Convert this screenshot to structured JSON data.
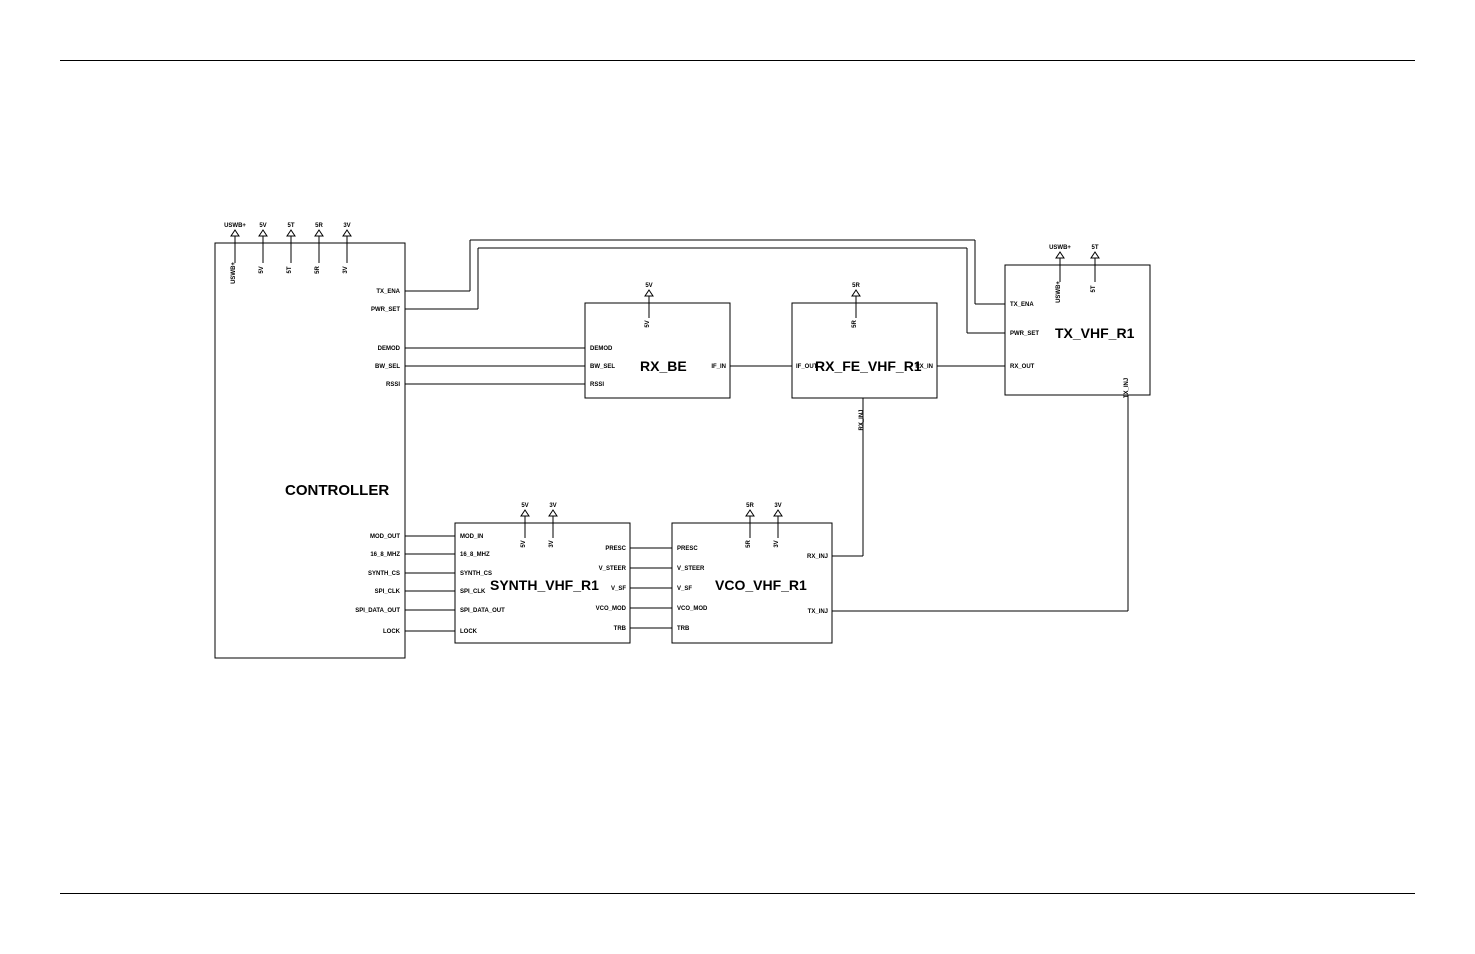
{
  "blocks": {
    "controller": {
      "title": "CONTROLLER",
      "top_pins": [
        "USWB+",
        "5V",
        "5T",
        "5R",
        "3V"
      ],
      "top_pins_inner": [
        "USWB+",
        "5V",
        "5T",
        "5R",
        "3V"
      ],
      "right_pins_upper": [
        "TX_ENA",
        "PWR_SET",
        "DEMOD",
        "BW_SEL",
        "RSSI"
      ],
      "right_pins_lower": [
        "MOD_OUT",
        "16_8_MHZ",
        "SYNTH_CS",
        "SPI_CLK",
        "SPI_DATA_OUT",
        "LOCK"
      ]
    },
    "rx_be": {
      "title": "RX_BE",
      "top_pin": "5V",
      "top_pin_inner": "5V",
      "left_pins": [
        "DEMOD",
        "BW_SEL",
        "RSSI"
      ],
      "right_pins": [
        "IF_IN"
      ]
    },
    "rx_fe": {
      "title": "RX_FE_VHF_R1",
      "top_pin": "5R",
      "top_pin_inner": "5R",
      "left_pins": [
        "IF_OUT"
      ],
      "right_pins": [
        "RX_IN"
      ],
      "bottom_pin": "RX_INJ"
    },
    "tx": {
      "title": "TX_VHF_R1",
      "top_pins": [
        "USWB+",
        "5T"
      ],
      "top_pins_inner": [
        "USWB+",
        "5T"
      ],
      "left_pins": [
        "TX_ENA",
        "PWR_SET",
        "RX_OUT"
      ],
      "bottom_pin": "TX_INJ"
    },
    "synth": {
      "title": "SYNTH_VHF_R1",
      "top_pins": [
        "5V",
        "3V"
      ],
      "top_pins_inner": [
        "5V",
        "3V"
      ],
      "left_pins": [
        "MOD_IN",
        "16_8_MHZ",
        "SYNTH_CS",
        "SPI_CLK",
        "SPI_DATA_OUT",
        "LOCK"
      ],
      "right_pins": [
        "PRESC",
        "V_STEER",
        "V_SF",
        "VCO_MOD",
        "TRB"
      ]
    },
    "vco": {
      "title": "VCO_VHF_R1",
      "top_pins": [
        "5R",
        "3V"
      ],
      "top_pins_inner": [
        "5R",
        "3V"
      ],
      "left_pins": [
        "PRESC",
        "V_STEER",
        "V_SF",
        "VCO_MOD",
        "TRB"
      ],
      "right_pins": [
        "RX_INJ",
        "TX_INJ"
      ]
    }
  }
}
